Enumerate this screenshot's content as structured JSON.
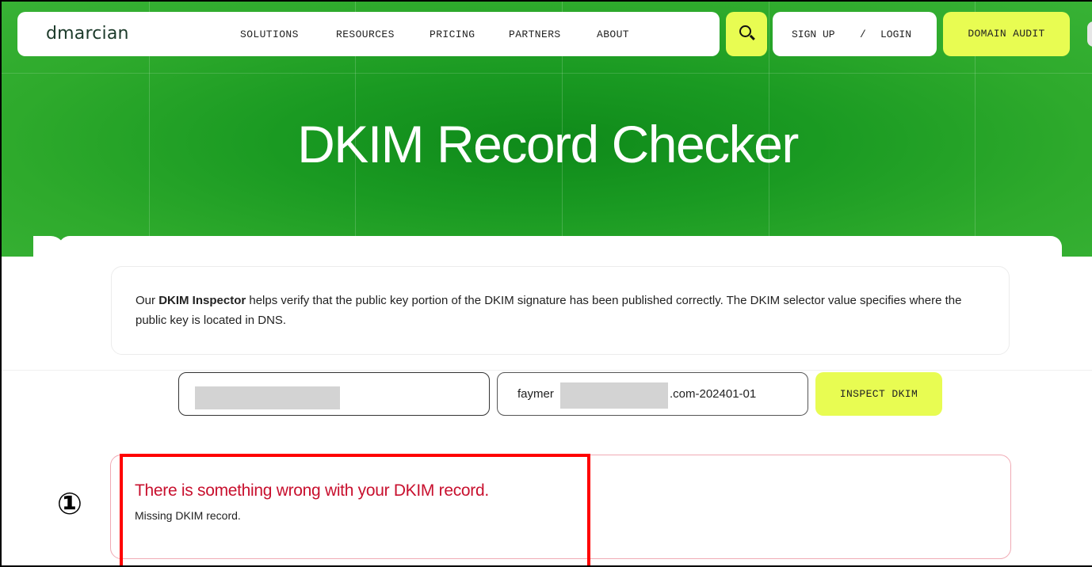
{
  "nav": {
    "logo": "dmarcian",
    "items": [
      "SOLUTIONS",
      "RESOURCES",
      "PRICING",
      "PARTNERS",
      "ABOUT"
    ],
    "signup": "SIGN UP",
    "divider": "/",
    "login": "LOGIN",
    "domain_audit": "DOMAIN AUDIT"
  },
  "hero": {
    "title": "DKIM Record Checker"
  },
  "info": {
    "prefix": "Our ",
    "bold": "DKIM Inspector",
    "rest": " helps verify that the public key portion of the DKIM signature has been published correctly. The DKIM selector value specifies where the public key is located in DNS."
  },
  "form": {
    "selector_prefix": "faymer",
    "selector_suffix": ".com-202401-01",
    "inspect_label": "INSPECT DKIM"
  },
  "result": {
    "title": "There is something wrong with your DKIM record.",
    "message": "Missing DKIM record."
  },
  "annotation": {
    "marker": "①",
    "color": "#ff0000"
  },
  "colors": {
    "accent": "#e8fc52",
    "hero_green": "#1a9a22",
    "error": "#c8102e"
  }
}
